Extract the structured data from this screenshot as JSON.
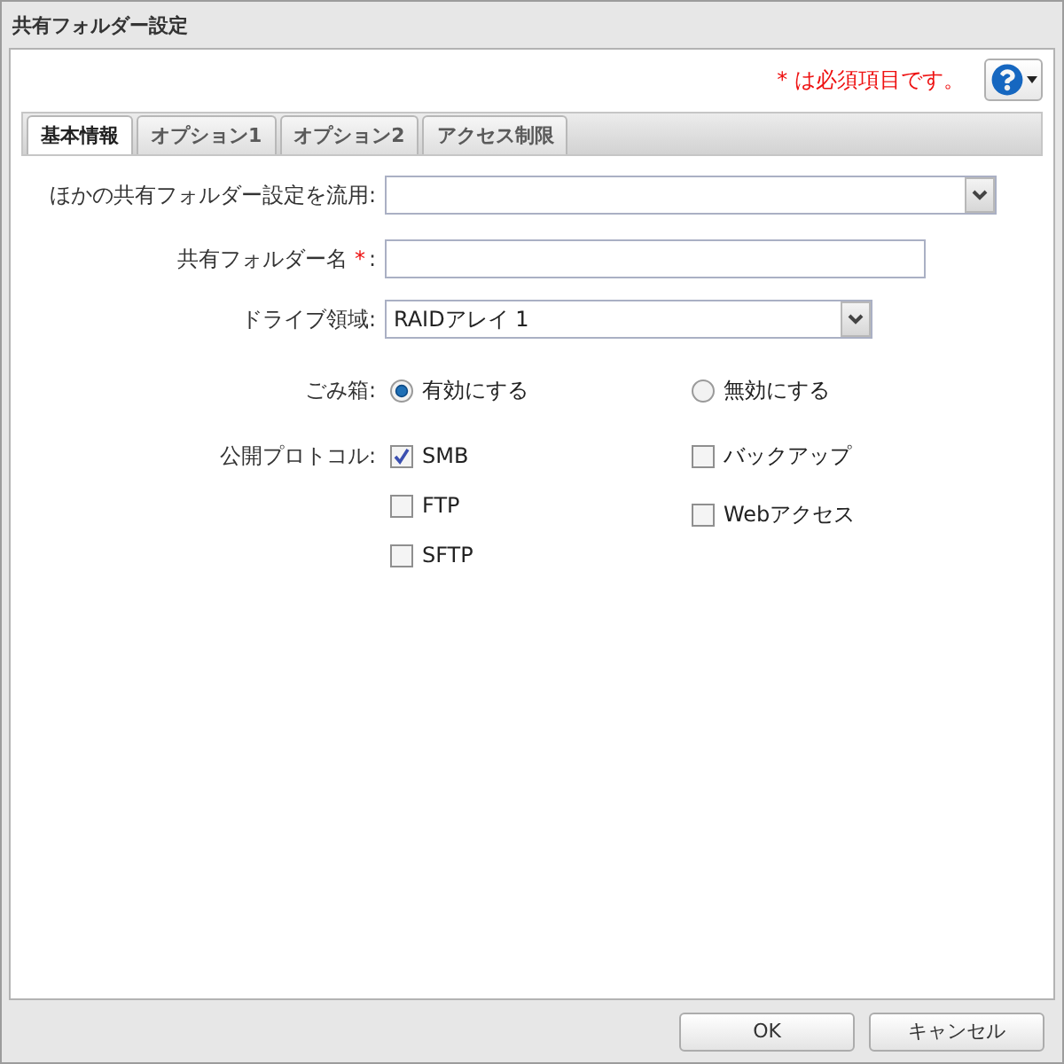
{
  "window": {
    "title": "共有フォルダー設定"
  },
  "required_note": "* は必須項目です。",
  "tabs": [
    {
      "label": "基本情報",
      "selected": true
    },
    {
      "label": "オプション1",
      "selected": false
    },
    {
      "label": "オプション2",
      "selected": false
    },
    {
      "label": "アクセス制限",
      "selected": false
    }
  ],
  "form": {
    "rows": [
      {
        "kind": "select",
        "label": "ほかの共有フォルダー設定を流用:"
      },
      {
        "kind": "text",
        "label": "共有フォルダー名",
        "required_mark": "*",
        "label_end": ":"
      },
      {
        "kind": "select",
        "label": "ドライブ領域:",
        "value": "RAIDアレイ 1"
      },
      {
        "kind": "radio",
        "label": "ごみ箱:",
        "options": [
          {
            "label": "有効にする",
            "selected": true
          },
          {
            "label": "無効にする",
            "selected": false
          }
        ]
      },
      {
        "kind": "checkbox",
        "label": "公開プロトコル:",
        "columns": [
          {
            "options": [
              {
                "label": "SMB",
                "checked": true
              },
              {
                "label": "FTP",
                "checked": false
              },
              {
                "label": "SFTP",
                "checked": false
              }
            ]
          },
          {
            "options": [
              {
                "label": "バックアップ",
                "checked": false
              },
              {
                "label": "Webアクセス",
                "checked": false
              }
            ]
          }
        ]
      }
    ]
  },
  "buttons": [
    {
      "label": "OK"
    },
    {
      "label": "キャンセル"
    }
  ]
}
